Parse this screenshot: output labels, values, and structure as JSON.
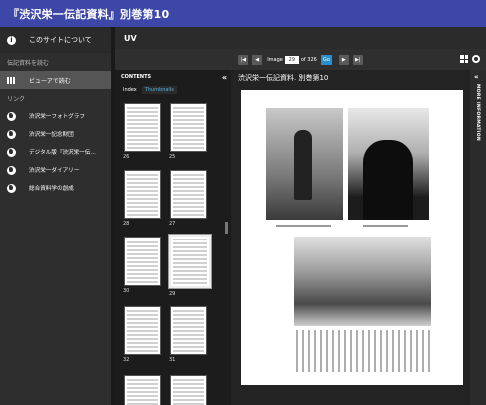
{
  "header": {
    "title": "『渋沢栄一伝記資料』別巻第10"
  },
  "sidebar": {
    "about_label": "このサイトについて",
    "read_section_label": "伝記資料を読む",
    "viewer_label": "ビューアで読む",
    "links_section_label": "リンク",
    "links": [
      "渋沢栄一フォトグラフ",
      "渋沢栄一記念財団",
      "デジタル版『渋沢栄一伝...",
      "渋沢栄一ダイアリー",
      "総合資料学の創成"
    ]
  },
  "viewer": {
    "app_title": "UV",
    "image_label": "Image",
    "image_value": "29",
    "of_label": "of 326",
    "go_label": "Go",
    "contents_label": "CONTENTS",
    "tabs": [
      "Index",
      "Thumbnails"
    ],
    "page_title": "渋沢栄一伝記資料. 別巻第10",
    "more_info_label": "MORE INFORMATION",
    "thumbnails": [
      {
        "label": "26"
      },
      {
        "label": "25"
      },
      {
        "label": "28"
      },
      {
        "label": "27"
      },
      {
        "label": "30"
      },
      {
        "label": "29"
      },
      {
        "label": "32"
      },
      {
        "label": "31"
      }
    ]
  }
}
